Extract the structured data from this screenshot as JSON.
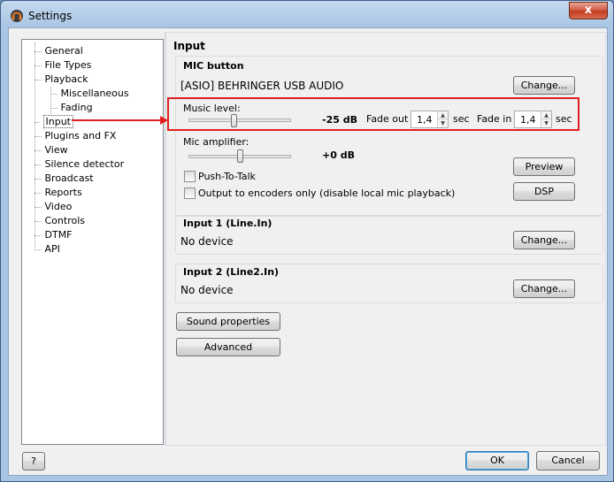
{
  "window": {
    "title": "Settings",
    "close_label": "x"
  },
  "tree": {
    "items": [
      {
        "label": "General"
      },
      {
        "label": "File Types"
      },
      {
        "label": "Playback"
      },
      {
        "label": "Miscellaneous"
      },
      {
        "label": "Fading"
      },
      {
        "label": "Input"
      },
      {
        "label": "Plugins and FX"
      },
      {
        "label": "View"
      },
      {
        "label": "Silence detector"
      },
      {
        "label": "Broadcast"
      },
      {
        "label": "Reports"
      },
      {
        "label": "Video"
      },
      {
        "label": "Controls"
      },
      {
        "label": "DTMF"
      },
      {
        "label": "API"
      }
    ],
    "selected": "Input"
  },
  "page": {
    "title": "Input"
  },
  "mic": {
    "group_title": "MIC button",
    "device": "[ASIO] BEHRINGER USB AUDIO",
    "change_label": "Change...",
    "music_level_label": "Music level:",
    "music_level_value": "-25 dB",
    "music_level_fraction": 0.44,
    "fade_out_label": "Fade out",
    "fade_out_value": "1,4",
    "fade_in_label": "Fade in",
    "fade_in_value": "1,4",
    "sec_label": "sec",
    "mic_amp_label": "Mic amplifier:",
    "mic_amp_value": "+0 dB",
    "mic_amp_fraction": 0.5,
    "push_to_talk_label": "Push-To-Talk",
    "output_encoders_label": "Output to encoders only (disable local mic playback)",
    "preview_label": "Preview",
    "dsp_label": "DSP"
  },
  "input1": {
    "title": "Input 1 (Line.In)",
    "device": "No device",
    "change_label": "Change..."
  },
  "input2": {
    "title": "Input 2 (Line2.In)",
    "device": "No device",
    "change_label": "Change..."
  },
  "buttons": {
    "sound_properties": "Sound properties",
    "advanced": "Advanced",
    "help": "?",
    "ok": "OK",
    "cancel": "Cancel"
  },
  "colors": {
    "annotation": "#e02020",
    "accent": "#3c7fb1"
  }
}
